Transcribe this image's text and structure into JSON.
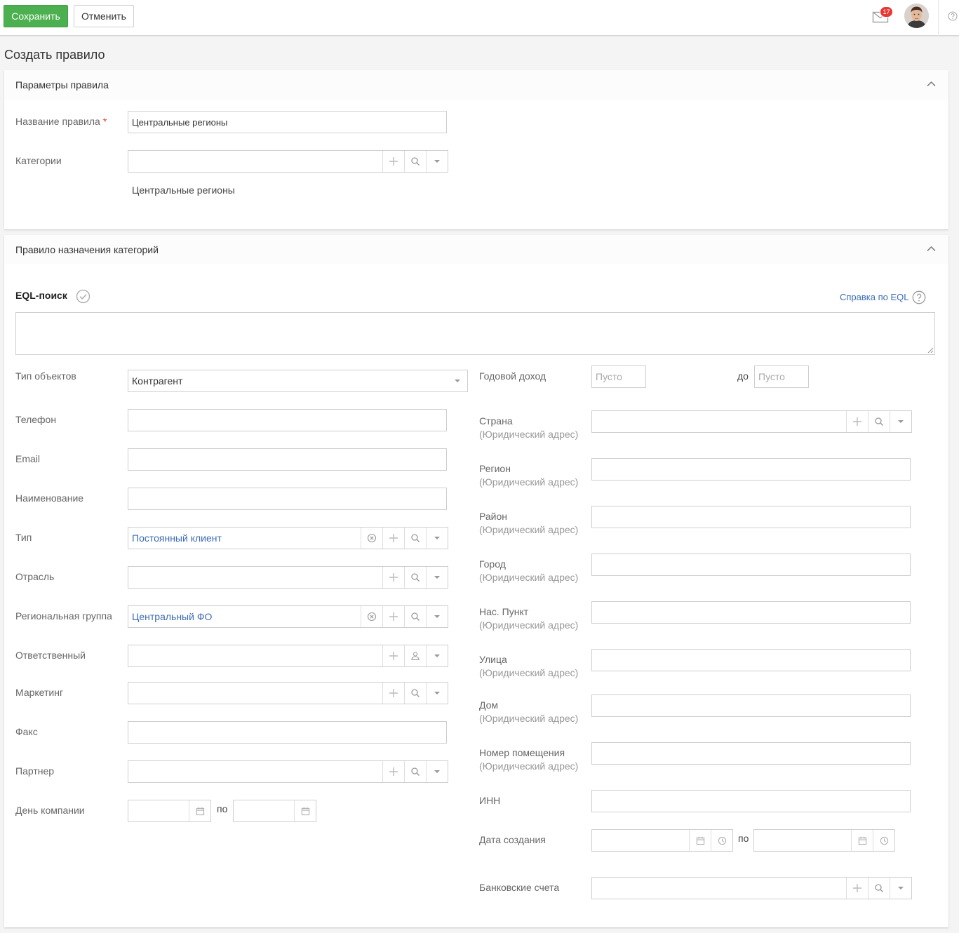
{
  "toolbar": {
    "save_label": "Сохранить",
    "cancel_label": "Отменить",
    "notifications_count": "17"
  },
  "page": {
    "title": "Создать правило"
  },
  "params_panel": {
    "title": "Параметры правила",
    "name_label": "Название правила",
    "required_mark": "*",
    "name_value": "Центральные регионы",
    "categories_label": "Категории",
    "categories_value": "",
    "selected_category": "Центральные регионы"
  },
  "rule_panel": {
    "title": "Правило назначения категорий",
    "eql_label": "EQL-поиск",
    "eql_help_link": "Справка по EQL",
    "eql_value": "",
    "left_fields": {
      "object_type": {
        "label": "Тип объектов",
        "value": "Контрагент"
      },
      "phone": {
        "label": "Телефон",
        "value": ""
      },
      "email": {
        "label": "Email",
        "value": ""
      },
      "name": {
        "label": "Наименование",
        "value": ""
      },
      "type": {
        "label": "Тип",
        "value": "Постоянный клиент"
      },
      "industry": {
        "label": "Отрасль",
        "value": ""
      },
      "regional_group": {
        "label": "Региональная группа",
        "value": "Центральный ФО"
      },
      "responsible": {
        "label": "Ответственный",
        "value": ""
      },
      "marketing": {
        "label": "Маркетинг",
        "value": ""
      },
      "fax": {
        "label": "Факс",
        "value": ""
      },
      "partner": {
        "label": "Партнер",
        "value": ""
      },
      "company_day": {
        "label": "День компании",
        "range_sep": "по"
      }
    },
    "right_fields": {
      "annual_income": {
        "label": "Годовой доход",
        "from_placeholder": "Пусто",
        "to_label": "до",
        "to_placeholder": "Пусто"
      },
      "address_sublabel": "(Юридический адрес)",
      "country": {
        "label": "Страна",
        "value": ""
      },
      "region": {
        "label": "Регион",
        "value": ""
      },
      "district": {
        "label": "Район",
        "value": ""
      },
      "city": {
        "label": "Город",
        "value": ""
      },
      "settlement": {
        "label": "Нас. Пункт",
        "value": ""
      },
      "street": {
        "label": "Улица",
        "value": ""
      },
      "house": {
        "label": "Дом",
        "value": ""
      },
      "room": {
        "label": "Номер помещения",
        "value": ""
      },
      "inn": {
        "label": "ИНН",
        "value": ""
      },
      "created_date": {
        "label": "Дата создания",
        "range_sep": "по"
      },
      "bank_accounts": {
        "label": "Банковские счета",
        "value": ""
      }
    }
  },
  "colors": {
    "save": "#4caf50",
    "link": "#3b6bb5",
    "badge": "#e53935"
  }
}
